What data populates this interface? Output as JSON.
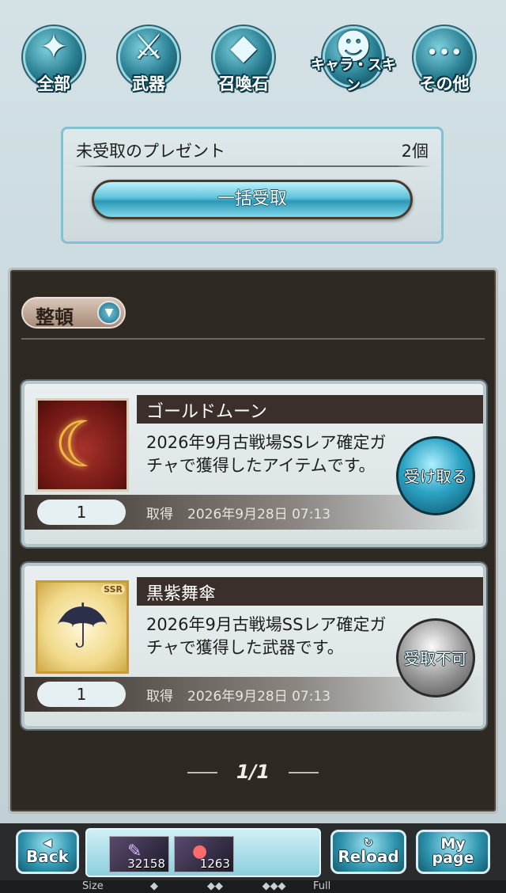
{
  "categories": [
    {
      "label": "全部",
      "icon": "all-items-icon",
      "glyph": "✦"
    },
    {
      "label": "武器",
      "icon": "sword-icon",
      "glyph": "⚔"
    },
    {
      "label": "召喚石",
      "icon": "crystal-icon",
      "glyph": "◆"
    },
    {
      "label": "キャラ・スキン",
      "icon": "character-icon",
      "glyph": "☻"
    },
    {
      "label": "その他",
      "icon": "more-icon",
      "glyph": "•••"
    }
  ],
  "present": {
    "title": "未受取のプレゼント",
    "count": "2個",
    "bulk_label": "一括受取"
  },
  "sort": {
    "label": "整頓",
    "arrow": "▼"
  },
  "items": [
    {
      "name": "ゴールドムーン",
      "desc": "2026年9月古戦場SSレア確定ガチャで獲得したアイテムです。",
      "qty": "1",
      "acq_label": "取得",
      "acq_date": "2026年9月28日 07:13",
      "action": "受け取る",
      "thumb_glyph": "☾",
      "thumb_icon": "gold-moon-icon"
    },
    {
      "name": "黒紫舞傘",
      "desc": "2026年9月古戦場SSレア確定ガチャで獲得した武器です。",
      "qty": "1",
      "acq_label": "取得",
      "acq_date": "2026年9月28日 07:13",
      "action": "受取不可",
      "thumb_glyph": "☂",
      "thumb_icon": "umbrella-weapon-icon",
      "rarity": "SSR"
    }
  ],
  "pager": "1/1",
  "bottom": {
    "back": "Back",
    "back_icon": "◀",
    "reload": "Reload",
    "reload_icon": "↻",
    "mypage_1": "My",
    "mypage_2": "page",
    "stash": [
      {
        "count": "32158",
        "icon": "weapon-stash-icon",
        "glyph": "✎"
      },
      {
        "count": "1263",
        "icon": "meat-icon",
        "glyph": "●"
      }
    ],
    "size_label": "Size",
    "full_label": "Full"
  },
  "colors": {
    "accent": "#2ca3c4",
    "panel": "#2f2924",
    "namebar": "#3a2f2a"
  }
}
